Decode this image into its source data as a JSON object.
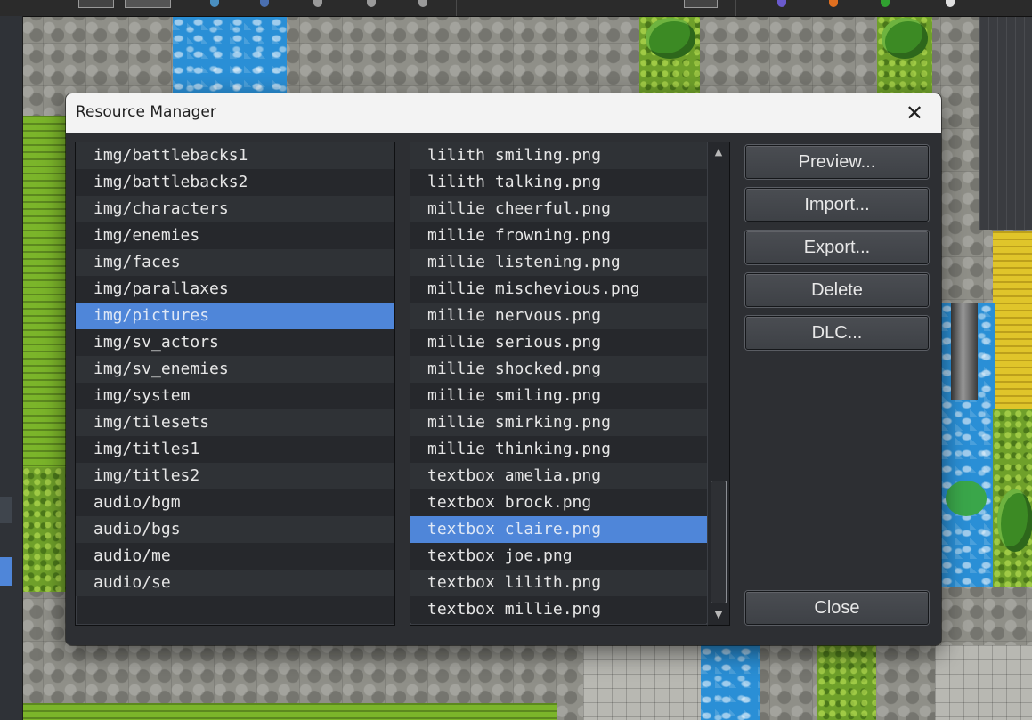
{
  "dialog": {
    "title": "Resource Manager",
    "close_icon": "✕"
  },
  "folders": {
    "items": [
      "img/battlebacks1",
      "img/battlebacks2",
      "img/characters",
      "img/enemies",
      "img/faces",
      "img/parallaxes",
      "img/pictures",
      "img/sv_actors",
      "img/sv_enemies",
      "img/system",
      "img/tilesets",
      "img/titles1",
      "img/titles2",
      "audio/bgm",
      "audio/bgs",
      "audio/me",
      "audio/se"
    ],
    "selected": "img/pictures"
  },
  "files": {
    "items": [
      "lilith smiling.png",
      "lilith talking.png",
      "millie cheerful.png",
      "millie frowning.png",
      "millie listening.png",
      "millie mischevious.png",
      "millie nervous.png",
      "millie serious.png",
      "millie shocked.png",
      "millie smiling.png",
      "millie smirking.png",
      "millie thinking.png",
      "textbox amelia.png",
      "textbox brock.png",
      "textbox claire.png",
      "textbox joe.png",
      "textbox lilith.png",
      "textbox millie.png"
    ],
    "selected": "textbox claire.png"
  },
  "scrollbar": {
    "up_icon": "▲",
    "down_icon": "▼"
  },
  "buttons": {
    "preview": "Preview...",
    "import": "Import...",
    "export": "Export...",
    "delete": "Delete",
    "dlc": "DLC...",
    "close": "Close"
  },
  "colors": {
    "selection": "#4f86d9",
    "dialog_bg": "#2d2f33",
    "titlebar_bg": "#f3f3f3"
  }
}
